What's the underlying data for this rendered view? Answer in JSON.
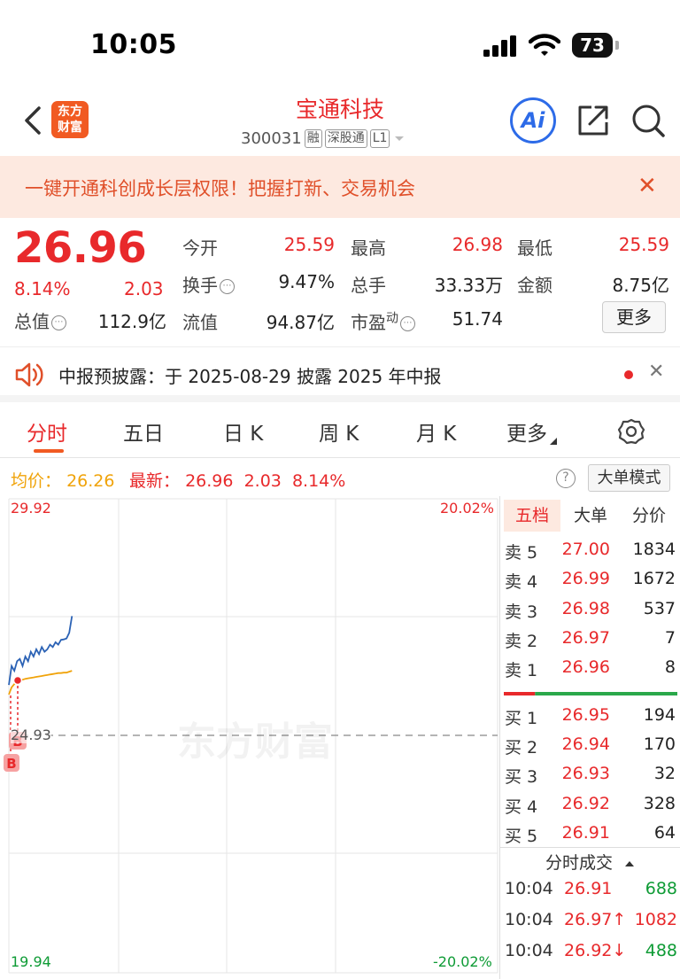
{
  "status": {
    "time": "10:05",
    "battery": "73"
  },
  "nav": {
    "logo_line1": "东方",
    "logo_line2": "财富",
    "stock_name": "宝通科技",
    "code": "300031",
    "tag_margin": "融",
    "tag_connect": "深股通",
    "tag_level": "L1",
    "ai_label": "Ai"
  },
  "banner": {
    "text": "一键开通科创成长层权限！把握打新、交易机会",
    "close": "✕"
  },
  "quote": {
    "price": "26.96",
    "pct": "8.14%",
    "change": "2.03",
    "total_label": "总值",
    "total_value": "112.9亿",
    "open_label": "今开",
    "open_value": "25.59",
    "high_label": "最高",
    "high_value": "26.98",
    "low_label": "最低",
    "low_value": "25.59",
    "turnover_label": "换手",
    "turnover_value": "9.47%",
    "volume_label": "总手",
    "volume_value": "33.33万",
    "amount_label": "金额",
    "amount_value": "8.75亿",
    "float_label": "流值",
    "float_value": "94.87亿",
    "pe_label": "市盈",
    "pe_sup": "动",
    "pe_value": "51.74",
    "more_button": "更多"
  },
  "notice": {
    "text": "中报预披露：于 2025-08-29 披露 2025 年中报",
    "close": "✕"
  },
  "tabs": [
    "分时",
    "五日",
    "日 K",
    "周 K",
    "月 K",
    "更多"
  ],
  "chart_info": {
    "avg_label": "均价：",
    "avg_value": "26.26",
    "latest_label": "最新：",
    "latest_price": "26.96",
    "latest_change": "2.03",
    "latest_pct": "8.14%",
    "help": "?",
    "mode_button": "大单模式"
  },
  "chart": {
    "y_top": "29.92",
    "y_bottom": "19.94",
    "y_mid": "24.93",
    "pct_top": "20.02%",
    "pct_bottom": "-20.02%",
    "watermark": "东方财富",
    "marker_b": "B"
  },
  "chart_data": {
    "type": "line",
    "ylim": [
      19.94,
      29.92
    ],
    "baseline": 24.93,
    "series": [
      {
        "values": [
          26.0,
          26.4,
          26.3,
          26.5,
          26.55,
          26.4,
          26.6,
          26.5,
          26.7,
          26.6,
          26.75,
          26.65,
          26.8,
          26.7,
          26.75,
          26.85,
          26.8,
          26.9,
          26.85,
          26.95,
          26.96,
          26.98,
          27.1,
          27.45
        ]
      },
      {
        "values": [
          25.8,
          25.95,
          26.02,
          26.06,
          26.09,
          26.11,
          26.13,
          26.14,
          26.15,
          26.16,
          26.17,
          26.18,
          26.19,
          26.2,
          26.21,
          26.22,
          26.23,
          26.24,
          26.25,
          26.25,
          26.26,
          26.26,
          26.28,
          26.3
        ]
      }
    ]
  },
  "order_book": {
    "tabs": [
      "五档",
      "大单",
      "分价"
    ],
    "asks": [
      {
        "label": "卖 5",
        "price": "27.00",
        "volume": "1834"
      },
      {
        "label": "卖 4",
        "price": "26.99",
        "volume": "1672"
      },
      {
        "label": "卖 3",
        "price": "26.98",
        "volume": "537"
      },
      {
        "label": "卖 2",
        "price": "26.97",
        "volume": "7"
      },
      {
        "label": "卖 1",
        "price": "26.96",
        "volume": "8"
      }
    ],
    "bids": [
      {
        "label": "买 1",
        "price": "26.95",
        "volume": "194"
      },
      {
        "label": "买 2",
        "price": "26.94",
        "volume": "170"
      },
      {
        "label": "买 3",
        "price": "26.93",
        "volume": "32"
      },
      {
        "label": "买 4",
        "price": "26.92",
        "volume": "328"
      },
      {
        "label": "买 5",
        "price": "26.91",
        "volume": "64"
      }
    ],
    "buy_ratio": 0.18,
    "trades_title": "分时成交",
    "trades": [
      {
        "time": "10:04",
        "price": "26.91",
        "volume": "688"
      },
      {
        "time": "10:04",
        "price": "26.97↑",
        "volume": "1082"
      },
      {
        "time": "10:04",
        "price": "26.92↓",
        "volume": "488"
      }
    ]
  },
  "colors": {
    "up": "#e8292b",
    "down": "#0e9b35",
    "accent": "#f15a22",
    "price_line": "#2b62b5",
    "avg_line": "#f0a30a"
  }
}
